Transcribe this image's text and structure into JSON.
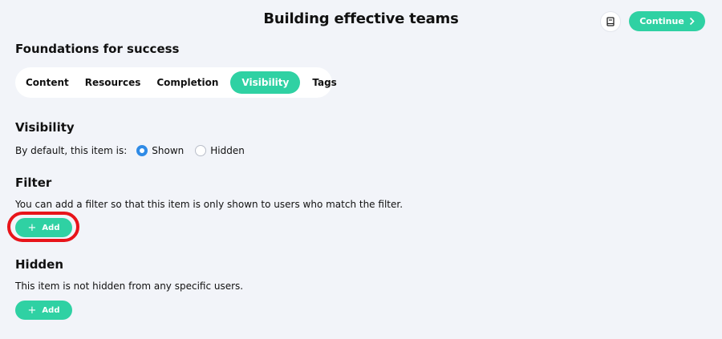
{
  "header": {
    "title": "Building effective teams",
    "continue_label": "Continue"
  },
  "section": {
    "title": "Foundations for success"
  },
  "tabs": [
    {
      "label": "Content"
    },
    {
      "label": "Resources"
    },
    {
      "label": "Completion"
    },
    {
      "label": "Visibility",
      "active": true
    },
    {
      "label": "Tags"
    }
  ],
  "visibility": {
    "heading": "Visibility",
    "default_label": "By default, this item is:",
    "options": [
      {
        "label": "Shown",
        "selected": true
      },
      {
        "label": "Hidden",
        "selected": false
      }
    ]
  },
  "filter": {
    "heading": "Filter",
    "description": "You can add a filter so that this item is only shown to users who match the filter.",
    "add_label": "Add"
  },
  "hidden": {
    "heading": "Hidden",
    "description": "This item is not hidden from any specific users.",
    "add_label": "Add"
  },
  "colors": {
    "accent": "#2fd1a3",
    "radio": "#2f8be6",
    "highlight": "#e8141a",
    "background": "#f2f4f9"
  },
  "icons": {
    "book": "book-icon",
    "chevron": "chevron-right-icon",
    "plus": "plus-icon"
  }
}
